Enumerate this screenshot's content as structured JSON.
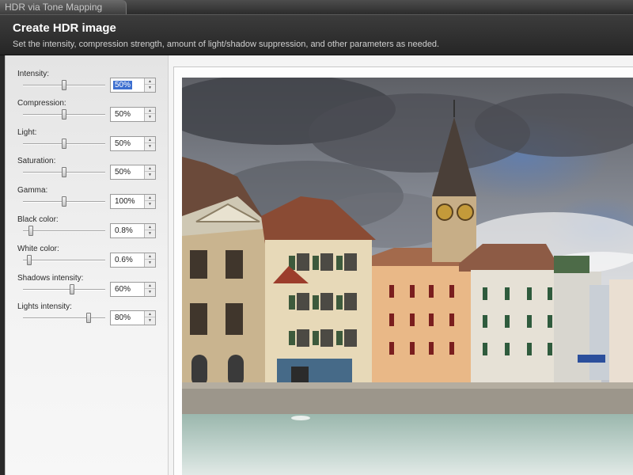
{
  "window": {
    "title": "HDR via Tone Mapping"
  },
  "header": {
    "title": "Create HDR image",
    "subtitle": "Set the intensity, compression strength, amount of light/shadow suppression, and other parameters as needed."
  },
  "parameters": [
    {
      "key": "intensity",
      "label": "Intensity:",
      "value": "50%",
      "level": 0.5,
      "selected": true
    },
    {
      "key": "compression",
      "label": "Compression:",
      "value": "50%",
      "level": 0.5
    },
    {
      "key": "light",
      "label": "Light:",
      "value": "50%",
      "level": 0.5
    },
    {
      "key": "saturation",
      "label": "Saturation:",
      "value": "50%",
      "level": 0.5
    },
    {
      "key": "gamma",
      "label": "Gamma:",
      "value": "100%",
      "level": 0.5
    },
    {
      "key": "black-color",
      "label": "Black color:",
      "value": "0.8%",
      "level": 0.1
    },
    {
      "key": "white-color",
      "label": "White color:",
      "value": "0.6%",
      "level": 0.08
    },
    {
      "key": "shadows-intensity",
      "label": "Shadows intensity:",
      "value": "60%",
      "level": 0.6
    },
    {
      "key": "lights-intensity",
      "label": "Lights intensity:",
      "value": "80%",
      "level": 0.8
    }
  ],
  "colors": {
    "selection": "#3d6fd0",
    "header_bg": "#2c2c2c",
    "panel_bg": "#f0f0f0"
  }
}
